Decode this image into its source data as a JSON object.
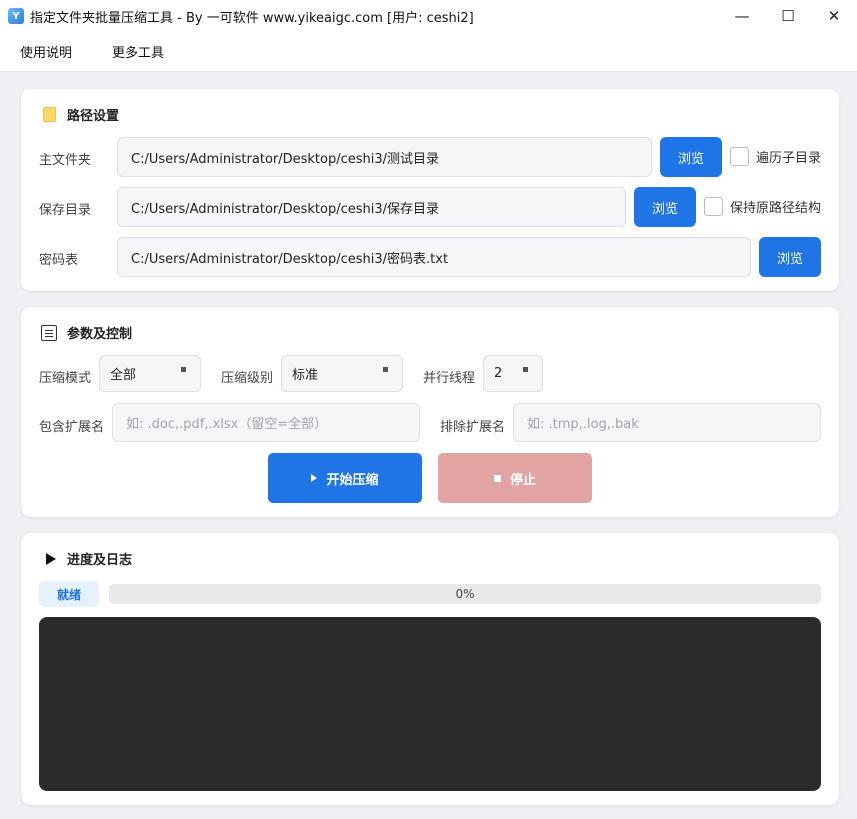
{
  "window": {
    "title": "指定文件夹批量压缩工具 - By 一可软件 www.yikeaigc.com [用户: ceshi2]",
    "icon": "app-logo-icon",
    "controls": {
      "minimize": "—",
      "maximize": "☐",
      "close": "✕"
    }
  },
  "menu": {
    "items": [
      "使用说明",
      "更多工具"
    ]
  },
  "path_settings": {
    "title": "路径设置",
    "icon": "folder-icon",
    "main_folder": {
      "label": "主文件夹",
      "value": "C:/Users/Administrator/Desktop/ceshi3/测试目录",
      "browse": "浏览",
      "checkbox_label": "遍历子目录"
    },
    "save_dir": {
      "label": "保存目录",
      "value": "C:/Users/Administrator/Desktop/ceshi3/保存目录",
      "browse": "浏览",
      "checkbox_label": "保持原路径结构"
    },
    "password_table": {
      "label": "密码表",
      "value": "C:/Users/Administrator/Desktop/ceshi3/密码表.txt",
      "browse": "浏览"
    }
  },
  "params": {
    "title": "参数及控制",
    "icon": "list-icon",
    "compress_mode": {
      "label": "压缩模式",
      "value": "全部"
    },
    "compress_level": {
      "label": "压缩级别",
      "value": "标准"
    },
    "threads": {
      "label": "并行线程",
      "value": "2"
    },
    "include_ext": {
      "label": "包含扩展名",
      "placeholder": "如: .doc,.pdf,.xlsx（留空=全部）"
    },
    "exclude_ext": {
      "label": "排除扩展名",
      "placeholder": "如: .tmp,.log,.bak"
    },
    "start_button": "开始压缩",
    "stop_button": "停止"
  },
  "progress": {
    "title": "进度及日志",
    "icon": "triangle-right-icon",
    "status": "就绪",
    "percent_text": "0%",
    "percent": 0,
    "log": ""
  },
  "colors": {
    "accent": "#1f74e6",
    "stop": "#e2a3a3",
    "log_bg": "#2b2b2b"
  }
}
